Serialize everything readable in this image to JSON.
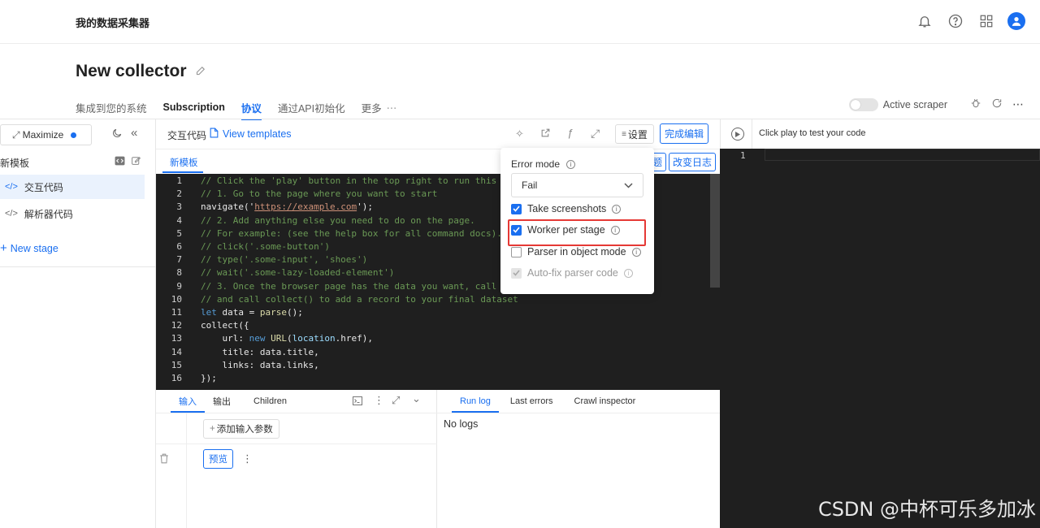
{
  "app": {
    "title": "我的数据采集器"
  },
  "page": {
    "title": "New collector"
  },
  "tabs": [
    "集成到您的系统",
    "Subscription",
    "协议",
    "通过API初始化",
    "更多"
  ],
  "header_right": {
    "active_scraper": "Active scraper"
  },
  "sidebar": {
    "maximize": "Maximize",
    "template_label": "新模板",
    "items": [
      "交互代码",
      "解析器代码"
    ],
    "new_stage": "New stage"
  },
  "editor": {
    "title": "交互代码",
    "view_templates": "View templates",
    "settings": "设置",
    "finish": "完成编辑",
    "changelog": "改变日志",
    "subtab": "新模板",
    "lines": [
      "// Click the 'play' button in the top right to run this",
      "// 1. Go to the page where you want to start",
      "navigate('https://example.com');",
      "// 2. Add anything else you need to do on the page.",
      "// For example: (see the help box for all command docs).",
      "// click('.some-button')",
      "// type('.some-input', 'shoes')",
      "// wait('.some-lazy-loaded-element')",
      "// 3. Once the browser page has the data you want, call",
      "// and call collect() to add a record to your final dataset",
      "let data = parse();",
      "collect({",
      "    url: new URL(location.href),",
      "    title: data.title,",
      "    links: data.links,",
      "});"
    ]
  },
  "popover": {
    "error_mode_label": "Error mode",
    "error_mode_value": "Fail",
    "options": [
      {
        "label": "Take screenshots",
        "checked": true
      },
      {
        "label": "Worker per stage",
        "checked": true
      },
      {
        "label": "Parser in object mode",
        "checked": false
      },
      {
        "label": "Auto-fix parser code",
        "checked": true,
        "disabled": true
      }
    ]
  },
  "bottom_left": {
    "tabs": [
      "输入",
      "输出",
      "Children"
    ],
    "add_param": "添加输入参数",
    "preview": "预览"
  },
  "bottom_right": {
    "tabs": [
      "Run log",
      "Last errors",
      "Crawl inspector"
    ],
    "empty": "No logs"
  },
  "test_panel": {
    "hint": "Click play to test your code",
    "line": "1"
  },
  "watermark": "CSDN @中杯可乐多加冰",
  "colors": {
    "accent": "#1a6ff0",
    "highlight": "#e53935",
    "editor_bg": "#1f1f1f"
  }
}
